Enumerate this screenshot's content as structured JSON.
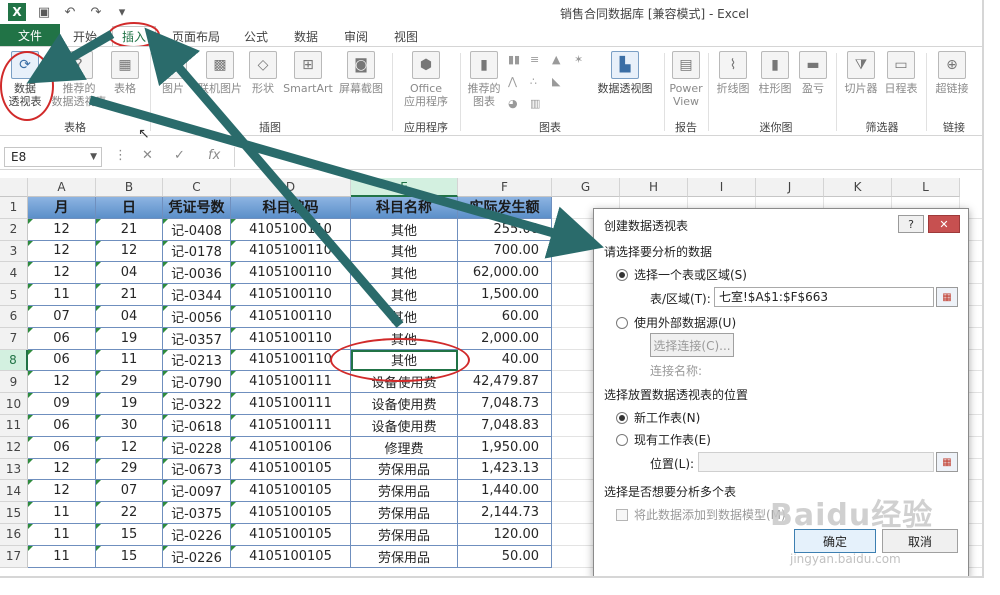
{
  "window": {
    "title": "销售合同数据库  [兼容模式] - Excel"
  },
  "tabs": [
    "文件",
    "开始",
    "插入",
    "页面布局",
    "公式",
    "数据",
    "审阅",
    "视图"
  ],
  "ribbon": {
    "pivot_table": "数据\n透视表",
    "recommended_pivot": "推荐的\n数据透视表",
    "table": "表格",
    "picture": "图片",
    "online_picture": "联机图片",
    "shapes": "形状",
    "smartart": "SmartArt",
    "screenshot": "屏幕截图",
    "office_apps": "Office\n应用程序",
    "recommended_charts": "推荐的\n图表",
    "pivot_chart": "数据透视图",
    "power_view": "Power\nView",
    "line": "折线图",
    "column": "柱形图",
    "win_loss": "盈亏",
    "slicer": "切片器",
    "timeline": "日程表",
    "hyperlink": "超链接",
    "groups": {
      "tables": "表格",
      "illustrations": "插图",
      "apps": "应用程序",
      "charts": "图表",
      "reports": "报告",
      "sparklines": "迷你图",
      "filters": "筛选器",
      "links": "链接"
    }
  },
  "formula_bar": {
    "name_box": "E8",
    "fx": "fx",
    "cancel": "✕",
    "enter": "✓"
  },
  "columns": [
    "A",
    "B",
    "C",
    "D",
    "E",
    "F",
    "G",
    "H",
    "I",
    "J",
    "K",
    "L"
  ],
  "rows": [
    "1",
    "2",
    "3",
    "4",
    "5",
    "6",
    "7",
    "8",
    "9",
    "10",
    "11",
    "12",
    "13",
    "14",
    "15",
    "16",
    "17"
  ],
  "table": {
    "headers": [
      "月",
      "日",
      "凭证号数",
      "科目编码",
      "科目名称",
      "实际发生额"
    ],
    "rows": [
      [
        "12",
        "21",
        "记-0408",
        "4105100110",
        "其他",
        "255.00"
      ],
      [
        "12",
        "12",
        "记-0178",
        "4105100110",
        "其他",
        "700.00"
      ],
      [
        "12",
        "04",
        "记-0036",
        "4105100110",
        "其他",
        "62,000.00"
      ],
      [
        "11",
        "21",
        "记-0344",
        "4105100110",
        "其他",
        "1,500.00"
      ],
      [
        "07",
        "04",
        "记-0056",
        "4105100110",
        "其他",
        "60.00"
      ],
      [
        "06",
        "19",
        "记-0357",
        "4105100110",
        "其他",
        "2,000.00"
      ],
      [
        "06",
        "11",
        "记-0213",
        "4105100110",
        "其他",
        "40.00"
      ],
      [
        "12",
        "29",
        "记-0790",
        "4105100111",
        "设备使用费",
        "42,479.87"
      ],
      [
        "09",
        "19",
        "记-0322",
        "4105100111",
        "设备使用费",
        "7,048.73"
      ],
      [
        "06",
        "30",
        "记-0618",
        "4105100111",
        "设备使用费",
        "7,048.83"
      ],
      [
        "06",
        "12",
        "记-0228",
        "4105100106",
        "修理费",
        "1,950.00"
      ],
      [
        "12",
        "29",
        "记-0673",
        "4105100105",
        "劳保用品",
        "1,423.13"
      ],
      [
        "12",
        "07",
        "记-0097",
        "4105100105",
        "劳保用品",
        "1,440.00"
      ],
      [
        "11",
        "22",
        "记-0375",
        "4105100105",
        "劳保用品",
        "2,144.73"
      ],
      [
        "11",
        "15",
        "记-0226",
        "4105100105",
        "劳保用品",
        "120.00"
      ],
      [
        "11",
        "15",
        "记-0226",
        "4105100105",
        "劳保用品",
        "50.00"
      ]
    ]
  },
  "dialog": {
    "title": "创建数据透视表",
    "help": "?",
    "close": "✕",
    "section1": "请选择要分析的数据",
    "opt_select_range": "选择一个表或区域(S)",
    "range_label": "表/区域(T):",
    "range_value": "七室!$A$1:$F$663",
    "opt_external": "使用外部数据源(U)",
    "choose_conn": "选择连接(C)...",
    "conn_name": "连接名称:",
    "section2": "选择放置数据透视表的位置",
    "opt_new_sheet": "新工作表(N)",
    "opt_existing_sheet": "现有工作表(E)",
    "location_label": "位置(L):",
    "section3": "选择是否想要分析多个表",
    "add_to_model": "将此数据添加到数据模型(M)",
    "ok": "确定",
    "cancel": "取消"
  },
  "watermark": {
    "brand": "Baidu经验",
    "url": "jingyan.baidu.com"
  },
  "colors": {
    "excel_green": "#217346",
    "header_blue": "#5b8fc9",
    "annotation_red": "#d12a2a",
    "arrow_teal": "#2a6b6b"
  }
}
